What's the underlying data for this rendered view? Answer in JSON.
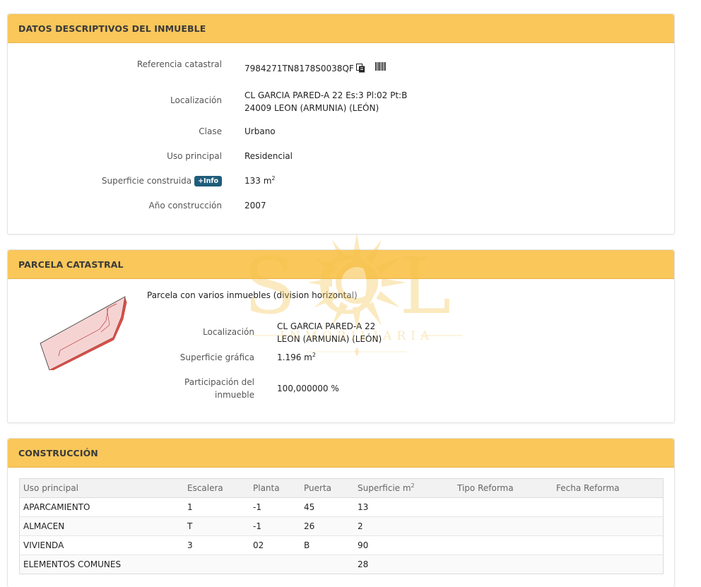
{
  "section1": {
    "title": "DATOS DESCRIPTIVOS DEL INMUEBLE",
    "fields": [
      {
        "label": "Referencia catastral",
        "value": "7984271TN8178S0038QF"
      },
      {
        "label": "Localización",
        "value_line1": "CL GARCIA PARED-A 22 Es:3 Pl:02 Pt:B",
        "value_line2": "24009 LEON (ARMUNIA) (LEÓN)"
      },
      {
        "label": "Clase",
        "value": "Urbano"
      },
      {
        "label": "Uso principal",
        "value": "Residencial"
      },
      {
        "label": "Superficie construida",
        "badge": "+Info",
        "value": "133 m",
        "unit_sup": "2"
      },
      {
        "label": "Año construcción",
        "value": "2007"
      }
    ]
  },
  "section2": {
    "title": "PARCELA CATASTRAL",
    "note": "Parcela con varios inmuebles (division horizontal)",
    "fields": [
      {
        "label": "Localización",
        "value_line1": "CL GARCIA PARED-A 22",
        "value_line2": "LEON (ARMUNIA) (LEÓN)"
      },
      {
        "label": "Superficie gráfica",
        "value": "1.196 m",
        "unit_sup": "2"
      },
      {
        "label_line1": "Participación del",
        "label_line2": "inmueble",
        "value": "100,000000 %"
      }
    ]
  },
  "section3": {
    "title": "CONSTRUCCIÓN",
    "columns": [
      "Uso principal",
      "Escalera",
      "Planta",
      "Puerta",
      "Superficie m",
      "Tipo Reforma",
      "Fecha Reforma"
    ],
    "superficie_sup": "2",
    "rows": [
      [
        "APARCAMIENTO",
        "1",
        "-1",
        "45",
        "13",
        "",
        ""
      ],
      [
        "ALMACEN",
        "T",
        "-1",
        "26",
        "2",
        "",
        ""
      ],
      [
        "VIVIENDA",
        "3",
        "02",
        "B",
        "90",
        "",
        ""
      ],
      [
        "ELEMENTOS COMUNES",
        "",
        "",
        "",
        "28",
        "",
        ""
      ]
    ]
  },
  "watermark": {
    "brand": "SOL",
    "sub": "INMOBILIARIA"
  },
  "colors": {
    "header_bg": "#f9c75a",
    "badge_bg": "#1f5d7a",
    "parcel_fill": "#f6d3d3",
    "parcel_stroke": "#c0392b"
  },
  "icons": [
    "copy-icon",
    "barcode-icon"
  ]
}
